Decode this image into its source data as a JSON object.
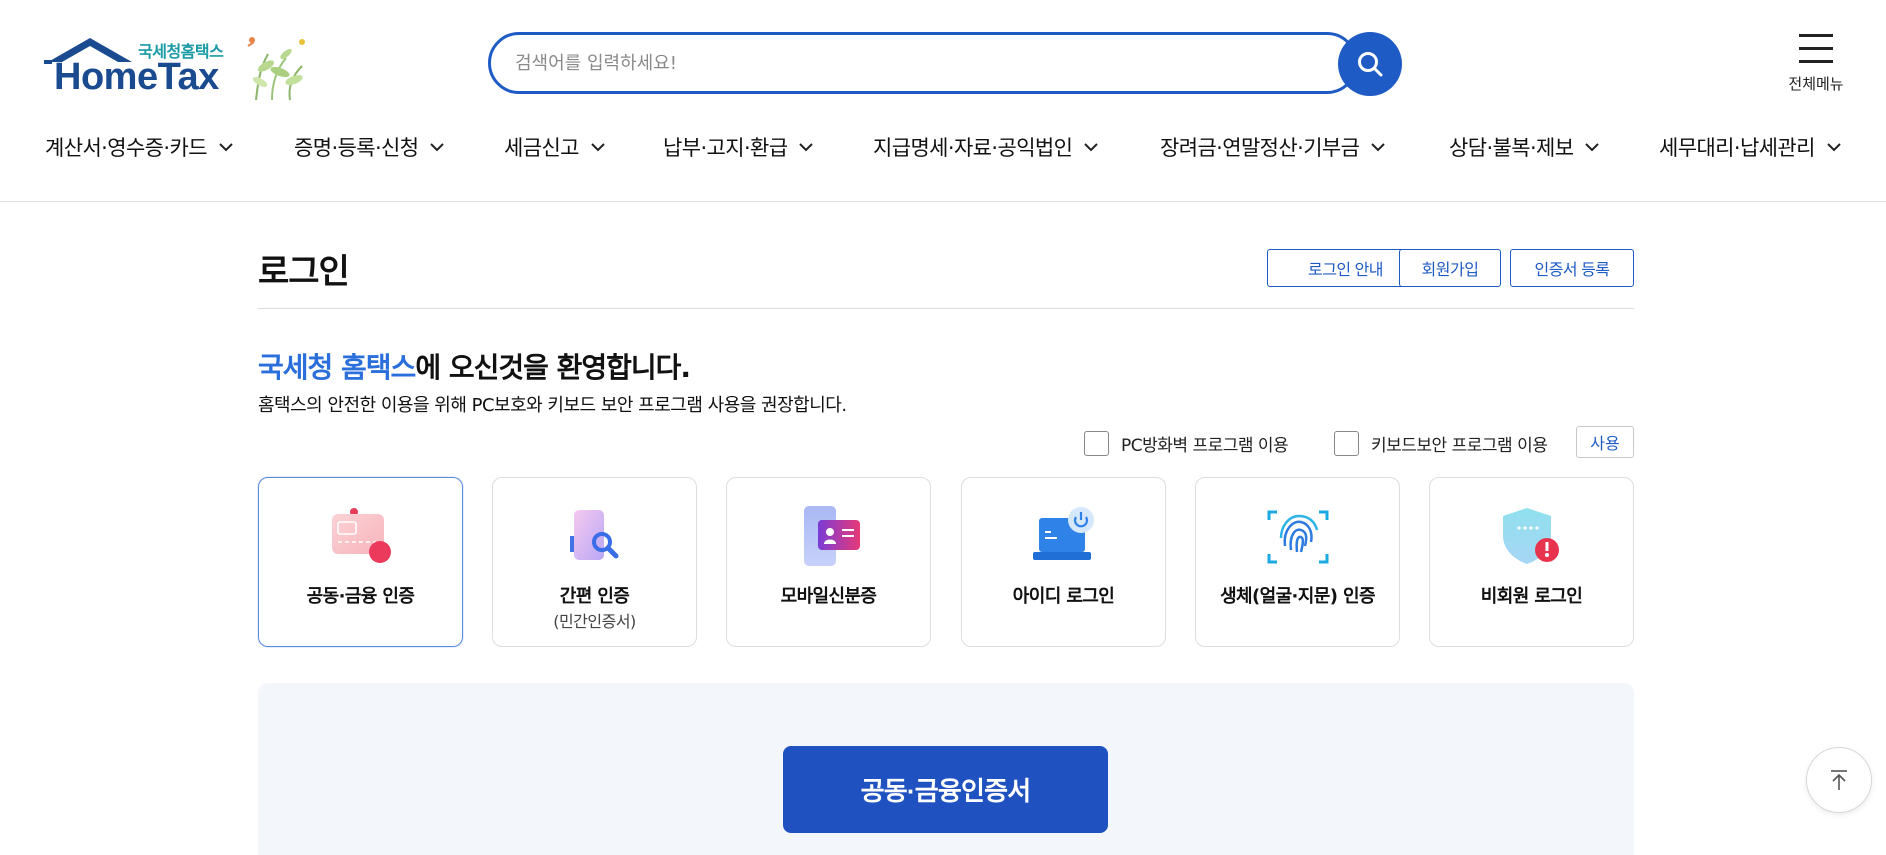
{
  "brand": {
    "korean_name": "국세청홈택스",
    "english_name": "HomeTax",
    "color": "#1a4a8f",
    "accent": "#1a9ba6"
  },
  "search": {
    "placeholder": "검색어를 입력하세요!",
    "value": "",
    "icon": "search-icon"
  },
  "all_menu": {
    "label": "전체메뉴",
    "icon": "hamburger-icon"
  },
  "nav": {
    "items": [
      {
        "label": "계산서·영수증·카드"
      },
      {
        "label": "증명·등록·신청"
      },
      {
        "label": "세금신고"
      },
      {
        "label": "납부·고지·환급"
      },
      {
        "label": "지급명세·자료·공익법인"
      },
      {
        "label": "장려금·연말정산·기부금"
      },
      {
        "label": "상담·불복·제보"
      },
      {
        "label": "세무대리·납세관리"
      }
    ]
  },
  "page": {
    "title": "로그인",
    "buttons": {
      "login_guide": "로그인 안내",
      "signup": "회원가입",
      "cert_register": "인증서 등록"
    },
    "welcome_accent": "국세청 홈택스",
    "welcome_rest": "에 오신것을 환영합니다.",
    "welcome_sub": "홈택스의 안전한 이용을 위해 PC보호와 키보드 보안 프로그램 사용을 권장합니다.",
    "options": {
      "firewall_label": "PC방화벽 프로그램 이용",
      "firewall_checked": false,
      "keyboard_label": "키보드보안 프로그램 이용",
      "keyboard_checked": false,
      "use_button": "사용"
    }
  },
  "login_methods": [
    {
      "label": "공동·금융 인증",
      "sublabel": "",
      "icon": "certificate-card-icon",
      "selected": true
    },
    {
      "label": "간편 인증",
      "sublabel": "(민간인증서)",
      "icon": "simple-auth-icon",
      "selected": false
    },
    {
      "label": "모바일신분증",
      "sublabel": "",
      "icon": "mobile-id-icon",
      "selected": false
    },
    {
      "label": "아이디 로그인",
      "sublabel": "",
      "icon": "laptop-login-icon",
      "selected": false
    },
    {
      "label": "생체(얼굴·지문) 인증",
      "sublabel": "",
      "icon": "fingerprint-icon",
      "selected": false
    },
    {
      "label": "비회원 로그인",
      "sublabel": "",
      "icon": "shield-guest-icon",
      "selected": false
    }
  ],
  "primary_action": {
    "label": "공동·금융인증서"
  },
  "colors": {
    "primary": "#1f5bc4",
    "primary_button": "#1f52c0",
    "welcome_accent": "#2a6fdb",
    "panel_bg": "#f3f6fb"
  },
  "scroll_top_icon": "arrow-up-icon"
}
